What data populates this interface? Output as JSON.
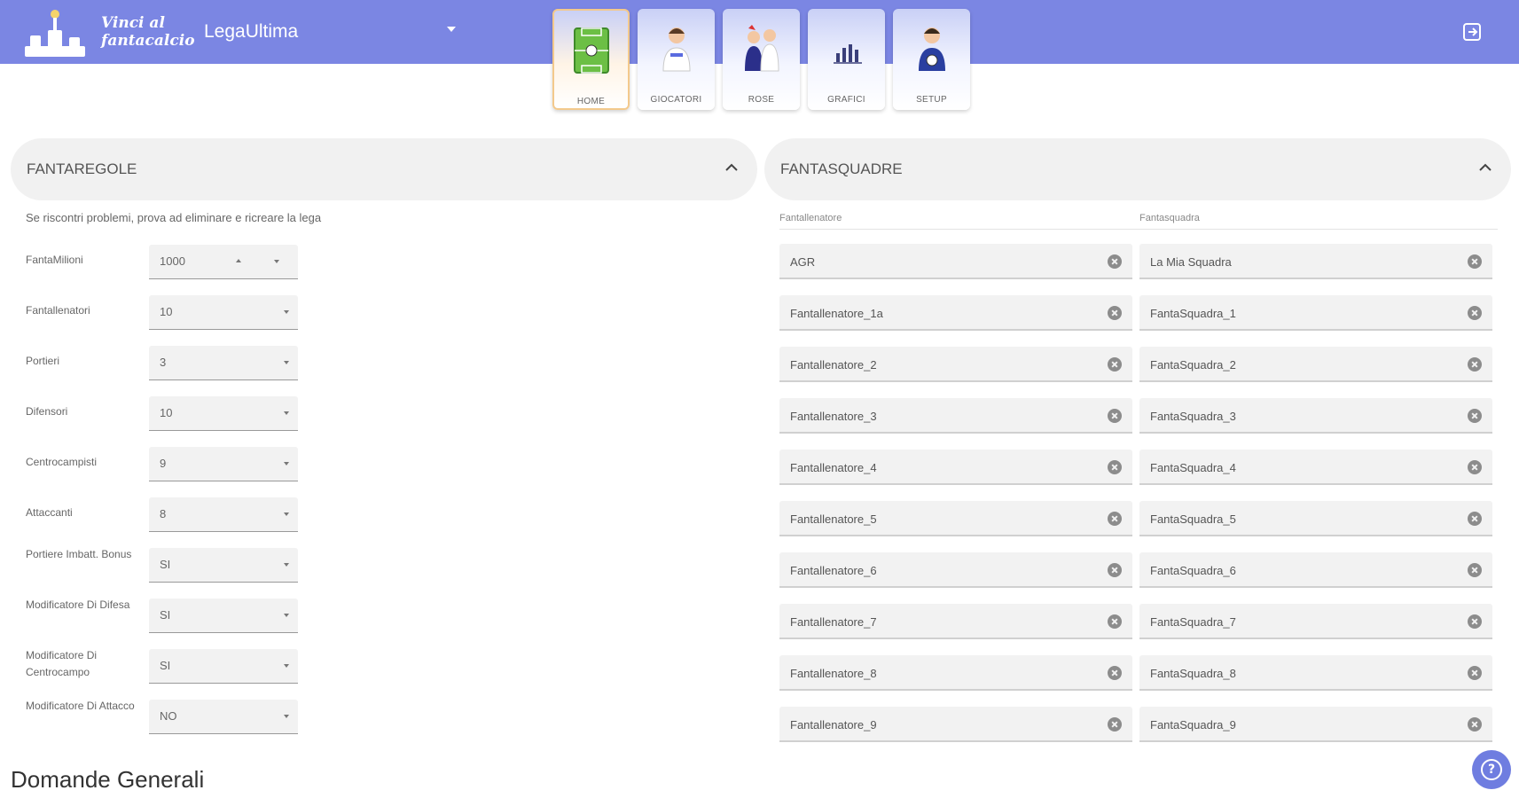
{
  "header": {
    "logo_text_line1": "Vinci al",
    "logo_text_line2": "fantacalcio",
    "league_name": "LegaUltima",
    "bar_color": "#7b86e3",
    "exit_icon": "logout-icon"
  },
  "nav": {
    "tabs": [
      {
        "label": "HOME",
        "icon": "soccer-field-icon",
        "active": true
      },
      {
        "label": "GIOCATORI",
        "icon": "player-icon",
        "active": false
      },
      {
        "label": "ROSE",
        "icon": "team-icon",
        "active": false
      },
      {
        "label": "GRAFICI",
        "icon": "chart-icon",
        "active": false
      },
      {
        "label": "SETUP",
        "icon": "setup-player-icon",
        "active": false
      }
    ]
  },
  "rules_panel": {
    "title": "FANTAREGOLE",
    "hint": "Se riscontri problemi, prova ad eliminare e ricreare la lega",
    "rows": [
      {
        "label": "FantaMilioni",
        "value": "1000",
        "kind": "number"
      },
      {
        "label": "Fantallenatori",
        "value": "10",
        "kind": "select"
      },
      {
        "label": "Portieri",
        "value": "3",
        "kind": "select"
      },
      {
        "label": "Difensori",
        "value": "10",
        "kind": "select"
      },
      {
        "label": "Centrocampisti",
        "value": "9",
        "kind": "select"
      },
      {
        "label": "Attaccanti",
        "value": "8",
        "kind": "select"
      },
      {
        "label": "Portiere Imbatt. Bonus",
        "value": "SI",
        "kind": "select"
      },
      {
        "label": "Modificatore Di Difesa",
        "value": "SI",
        "kind": "select"
      },
      {
        "label": "Modificatore Di Centrocampo",
        "value": "SI",
        "kind": "select"
      },
      {
        "label": "Modificatore Di Attacco",
        "value": "NO",
        "kind": "select"
      }
    ]
  },
  "teams_panel": {
    "title": "FANTASQUADRE",
    "col_coach": "Fantallenatore",
    "col_team": "Fantasquadra",
    "rows": [
      {
        "coach": "AGR",
        "team": "La Mia Squadra"
      },
      {
        "coach": "Fantallenatore_1a",
        "team": "FantaSquadra_1"
      },
      {
        "coach": "Fantallenatore_2",
        "team": "FantaSquadra_2"
      },
      {
        "coach": "Fantallenatore_3",
        "team": "FantaSquadra_3"
      },
      {
        "coach": "Fantallenatore_4",
        "team": "FantaSquadra_4"
      },
      {
        "coach": "Fantallenatore_5",
        "team": "FantaSquadra_5"
      },
      {
        "coach": "Fantallenatore_6",
        "team": "FantaSquadra_6"
      },
      {
        "coach": "Fantallenatore_7",
        "team": "FantaSquadra_7"
      },
      {
        "coach": "Fantallenatore_8",
        "team": "FantaSquadra_8"
      },
      {
        "coach": "Fantallenatore_9",
        "team": "FantaSquadra_9"
      }
    ]
  },
  "faq": {
    "title": "Domande Generali"
  },
  "help_button": {
    "icon": "help-icon",
    "glyph": "?"
  }
}
